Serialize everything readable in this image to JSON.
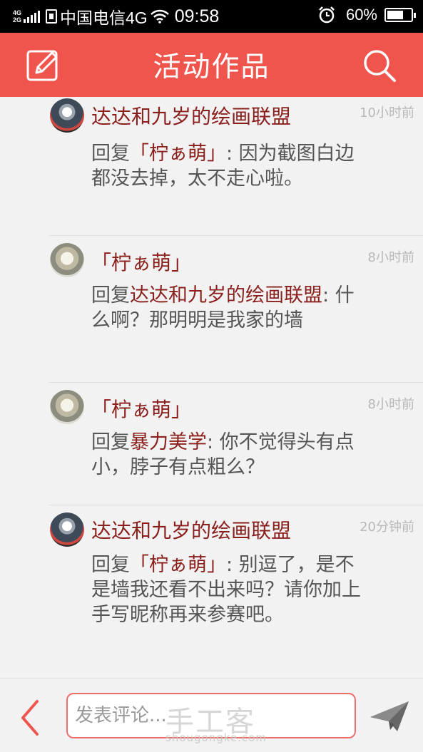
{
  "status_bar": {
    "network_top": "4G",
    "network_bottom": "2G",
    "carrier": "中国电信4G",
    "time": "09:58",
    "battery": "60%"
  },
  "header": {
    "title": "活动作品",
    "left_icon": "edit-icon",
    "right_icon": "search-icon",
    "color": "#f0554d"
  },
  "comments": [
    {
      "user": "达达和九岁的绘画联盟",
      "time": "10小时前",
      "avatar": "dark",
      "prefix": "回复",
      "mention": "「柠ぁ萌」",
      "text": ": 因为截图白边都没去掉，太不走心啦。"
    },
    {
      "user": "「柠ぁ萌」",
      "time": "8小时前",
      "avatar": "light",
      "prefix": "回复",
      "mention": "达达和九岁的绘画联盟",
      "text": ": 什么啊？那明明是我家的墙"
    },
    {
      "user": "「柠ぁ萌」",
      "time": "8小时前",
      "avatar": "light",
      "prefix": "回复",
      "mention": "暴力美学",
      "text": ": 你不觉得头有点小，脖子有点粗么？"
    },
    {
      "user": "达达和九岁的绘画联盟",
      "time": "20分钟前",
      "avatar": "dark",
      "prefix": "回复",
      "mention": "「柠ぁ萌」",
      "text": ": 别逗了，是不是墙我还看不出来吗？请你加上手写昵称再来参赛吧。"
    }
  ],
  "bottom_bar": {
    "placeholder": "发表评论...",
    "back_icon": "chevron-left-icon",
    "send_icon": "send-icon"
  },
  "watermark": {
    "main": "手工客",
    "sub": "shougongke.com"
  }
}
